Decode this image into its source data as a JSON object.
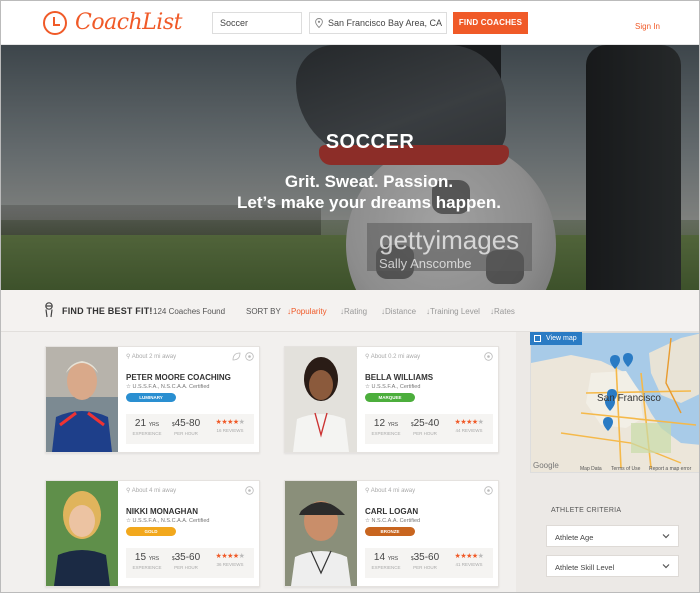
{
  "header": {
    "logo_text": "CoachList",
    "sport_value": "Soccer",
    "location_value": "San Francisco Bay Area, CA",
    "find_button": "FIND COACHES",
    "signin": "Sign In"
  },
  "hero": {
    "title": "SOCCER",
    "line1": "Grit. Sweat. Passion.",
    "line2": "Let’s make your dreams happen.",
    "watermark_main": "gettyimages",
    "watermark_sub": "Sally Anscombe"
  },
  "filter": {
    "title": "FIND THE BEST FIT!",
    "count": "124 Coaches Found",
    "sort_label": "SORT BY",
    "sorts": [
      "↓Popularity",
      "↓Rating",
      "↓Distance",
      "↓Training Level",
      "↓Rates"
    ]
  },
  "coaches": [
    {
      "location": "About 2 mi away",
      "name": "PETER MOORE COACHING",
      "certs": "U.S.S.F.A., N.S.C.A.A. Certified",
      "badge": "LUMINARY",
      "badge_color": "#2a8fd1",
      "years": "21",
      "rate": "45-80",
      "rating": 4,
      "reviews": "16 REVIEWS"
    },
    {
      "location": "About 0.2 mi away",
      "name": "BELLA WILLIAMS",
      "certs": "U.S.S.F.A., Certified",
      "badge": "MARQUEE",
      "badge_color": "#4cae3c",
      "years": "12",
      "rate": "25-40",
      "rating": 4,
      "reviews": "44 REVIEWS"
    },
    {
      "location": "About 4 mi away",
      "name": "NIKKI MONAGHAN",
      "certs": "U.S.S.F.A., N.S.C.A.A. Certified",
      "badge": "GOLD",
      "badge_color": "#f2a81d",
      "years": "15",
      "rate": "35-60",
      "rating": 4,
      "reviews": "36 REVIEWS"
    },
    {
      "location": "About 4 mi away",
      "name": "CARL LOGAN",
      "certs": "N.S.C.A.A. Certified",
      "badge": "BRONZE",
      "badge_color": "#c8651f",
      "years": "14",
      "rate": "35-60",
      "rating": 4,
      "reviews": "41 REVIEWS"
    }
  ],
  "labels": {
    "yrs": "YRS",
    "experience": "EXPERIENCE",
    "per_hour": "PER HOUR",
    "currency": "$"
  },
  "map": {
    "view_map": "View map",
    "city": "San Francisco",
    "google": "Google",
    "map_data": "Map Data",
    "terms": "Terms of Use",
    "report": "Report a map error"
  },
  "sidebar": {
    "athlete_criteria": "ATHLETE CRITERIA",
    "age_select": "Athlete Age",
    "skill_select": "Athlete Skill Level"
  },
  "colors": {
    "accent": "#f05a28",
    "map_blue": "#2a7bc4"
  }
}
